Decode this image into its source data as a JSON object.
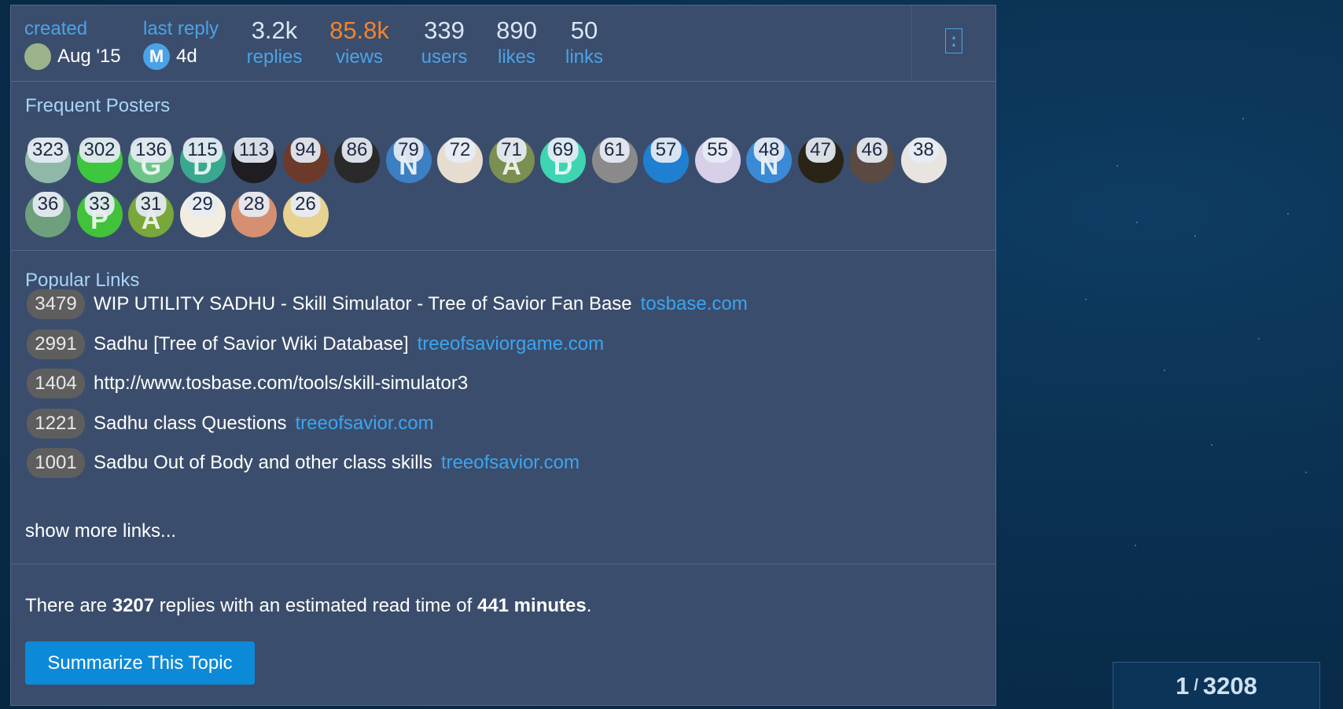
{
  "topic_map": {
    "created": {
      "label": "created",
      "value": "Aug '15"
    },
    "last_reply": {
      "label": "last reply",
      "value": "4d",
      "avatar_letter": "M"
    },
    "stats": [
      {
        "number": "3.2k",
        "label": "replies",
        "hot": false
      },
      {
        "number": "85.8k",
        "label": "views",
        "hot": true
      },
      {
        "number": "339",
        "label": "users",
        "hot": false
      },
      {
        "number": "890",
        "label": "likes",
        "hot": false
      },
      {
        "number": "50",
        "label": "links",
        "hot": false
      }
    ],
    "collapse_icon": "chevron-up-icon"
  },
  "frequent_posters": {
    "title": "Frequent Posters",
    "posters": [
      {
        "count": "323",
        "color": "#8fb8a8"
      },
      {
        "count": "302",
        "color": "#3fc63f"
      },
      {
        "count": "136",
        "color": "#6fc48a",
        "letter": "G"
      },
      {
        "count": "115",
        "color": "#38a98f",
        "letter": "D"
      },
      {
        "count": "113",
        "color": "#1d1d22"
      },
      {
        "count": "94",
        "color": "#6b3a2a"
      },
      {
        "count": "86",
        "color": "#2a2a2a"
      },
      {
        "count": "79",
        "color": "#3c7fc2",
        "letter": "N"
      },
      {
        "count": "72",
        "color": "#e7dcd0"
      },
      {
        "count": "71",
        "color": "#7b8f50",
        "letter": "A"
      },
      {
        "count": "69",
        "color": "#3ed6b2",
        "letter": "D"
      },
      {
        "count": "61",
        "color": "#8a8a8a"
      },
      {
        "count": "57",
        "color": "#1f7fd0"
      },
      {
        "count": "55",
        "color": "#d8d0e8"
      },
      {
        "count": "48",
        "color": "#3a8ad6",
        "letter": "N"
      },
      {
        "count": "47",
        "color": "#2a2417"
      },
      {
        "count": "46",
        "color": "#5a4a42"
      },
      {
        "count": "38",
        "color": "#e8e4e0"
      },
      {
        "count": "36",
        "color": "#6ea07e"
      },
      {
        "count": "33",
        "color": "#42c23a",
        "letter": "P"
      },
      {
        "count": "31",
        "color": "#78a83a",
        "letter": "A"
      },
      {
        "count": "29",
        "color": "#f2ede0"
      },
      {
        "count": "28",
        "color": "#d49070"
      },
      {
        "count": "26",
        "color": "#e8d290"
      }
    ]
  },
  "popular_links": {
    "title": "Popular Links",
    "links": [
      {
        "clicks": "3479",
        "title": "WIP UTILITY SADHU - Skill Simulator - Tree of Savior Fan Base",
        "domain": "tosbase.com"
      },
      {
        "clicks": "2991",
        "title": "Sadhu [Tree of Savior Wiki Database]",
        "domain": "treeofsaviorgame.com"
      },
      {
        "clicks": "1404",
        "title": "http://www.tosbase.com/tools/skill-simulator3",
        "domain": ""
      },
      {
        "clicks": "1221",
        "title": "Sadhu class Questions",
        "domain": "treeofsavior.com"
      },
      {
        "clicks": "1001",
        "title": "Sadbu Out of Body and other class skills",
        "domain": "treeofsavior.com"
      }
    ],
    "show_more": "show more links..."
  },
  "summary": {
    "prefix": "There are ",
    "replies": "3207",
    "middle": " replies with an estimated read time of ",
    "read_time": "441 minutes",
    "suffix": ".",
    "button_label": "Summarize This Topic"
  },
  "progress": {
    "current": "1",
    "total": "3208"
  }
}
